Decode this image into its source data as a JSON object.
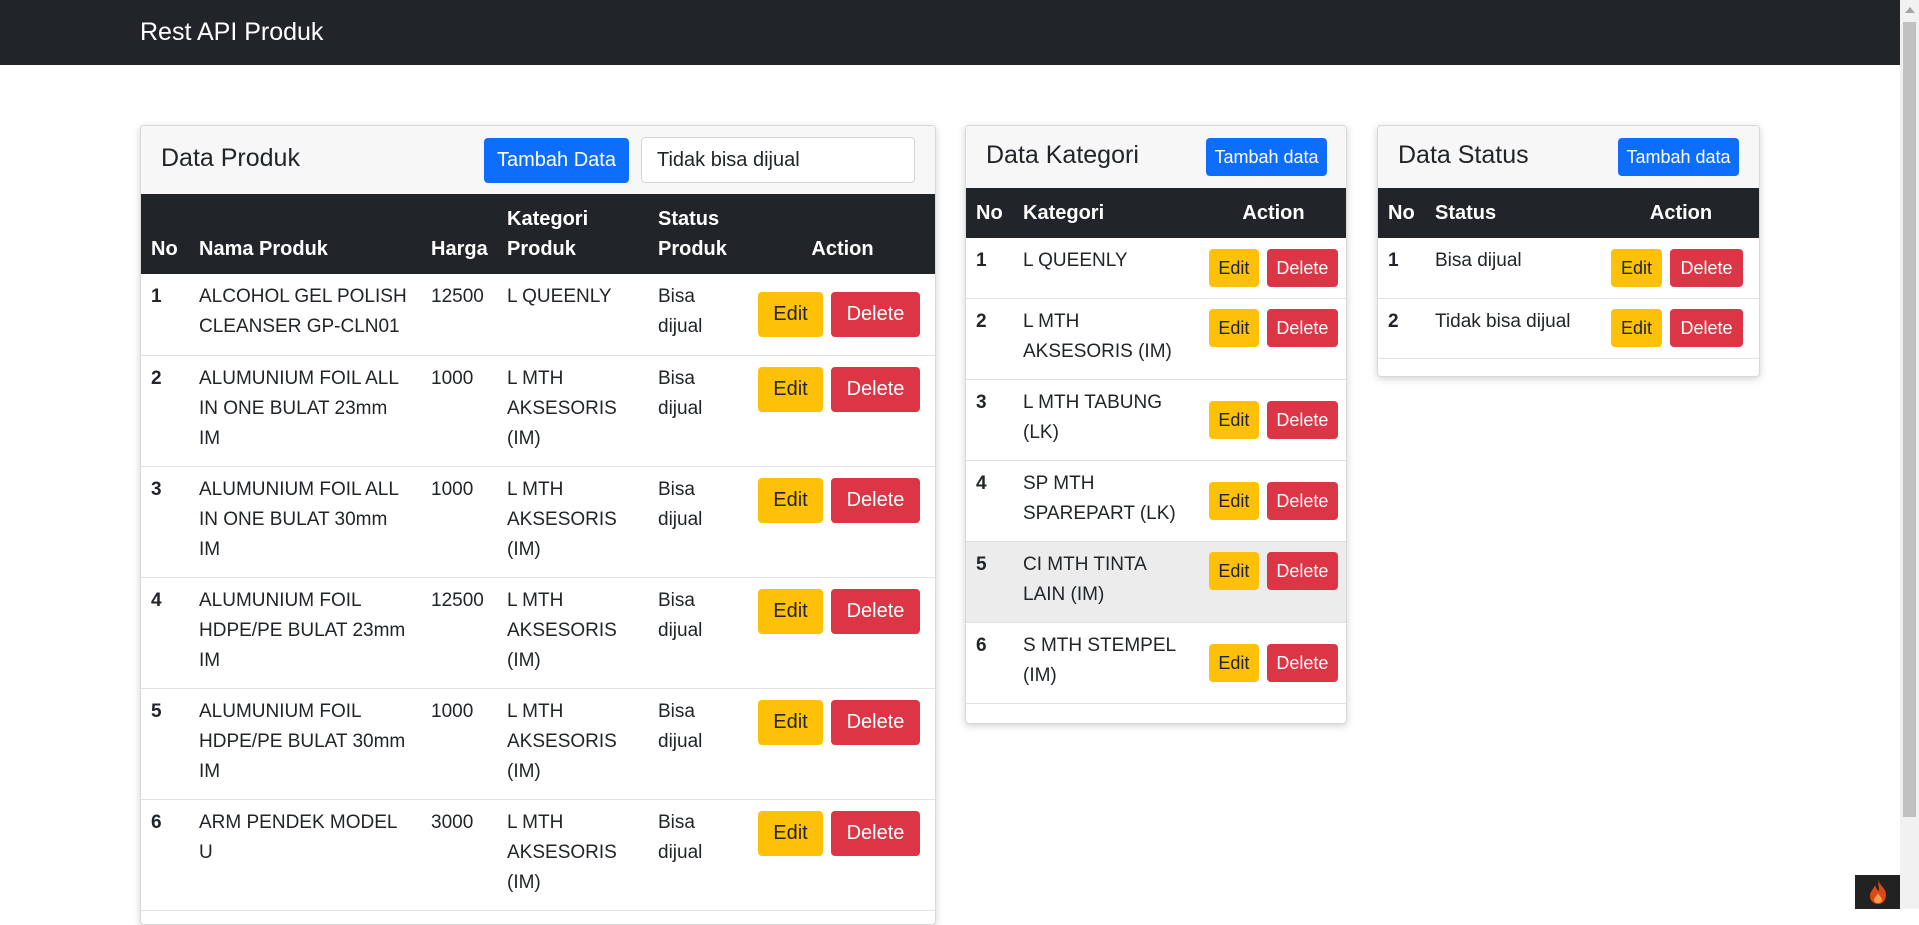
{
  "app": {
    "brand": "Rest API Produk"
  },
  "produk": {
    "title": "Data Produk",
    "add_label": "Tambah Data",
    "search_value": "Tidak bisa dijual",
    "columns": [
      "No",
      "Nama Produk",
      "Harga",
      "Kategori Produk",
      "Status Produk",
      "Action"
    ],
    "rows": [
      {
        "no": "1",
        "nama": "ALCOHOL GEL POLISH CLEANSER GP-CLN01",
        "harga": "12500",
        "kategori": "L QUEENLY",
        "status": "Bisa dijual"
      },
      {
        "no": "2",
        "nama": "ALUMUNIUM FOIL ALL IN ONE BULAT 23mm IM",
        "harga": "1000",
        "kategori": "L MTH AKSESORIS (IM)",
        "status": "Bisa dijual"
      },
      {
        "no": "3",
        "nama": "ALUMUNIUM FOIL ALL IN ONE BULAT 30mm IM",
        "harga": "1000",
        "kategori": "L MTH AKSESORIS (IM)",
        "status": "Bisa dijual"
      },
      {
        "no": "4",
        "nama": "ALUMUNIUM FOIL HDPE/PE BULAT 23mm IM",
        "harga": "12500",
        "kategori": "L MTH AKSESORIS (IM)",
        "status": "Bisa dijual"
      },
      {
        "no": "5",
        "nama": "ALUMUNIUM FOIL HDPE/PE BULAT 30mm IM",
        "harga": "1000",
        "kategori": "L MTH AKSESORIS (IM)",
        "status": "Bisa dijual"
      },
      {
        "no": "6",
        "nama": "ARM PENDEK MODEL U",
        "harga": "3000",
        "kategori": "L MTH AKSESORIS (IM)",
        "status": "Bisa dijual"
      }
    ]
  },
  "kategori": {
    "title": "Data Kategori",
    "add_label": "Tambah data",
    "columns": [
      "No",
      "Kategori",
      "Action"
    ],
    "rows": [
      {
        "no": "1",
        "kategori": "L QUEENLY"
      },
      {
        "no": "2",
        "kategori": "L MTH AKSESORIS (IM)"
      },
      {
        "no": "3",
        "kategori": "L MTH TABUNG (LK)"
      },
      {
        "no": "4",
        "kategori": "SP MTH SPAREPART (LK)"
      },
      {
        "no": "5",
        "kategori": "CI MTH TINTA LAIN (IM)"
      },
      {
        "no": "6",
        "kategori": "S MTH STEMPEL (IM)"
      }
    ]
  },
  "status": {
    "title": "Data Status",
    "add_label": "Tambah data",
    "columns": [
      "No",
      "Status",
      "Action"
    ],
    "rows": [
      {
        "no": "1",
        "status": "Bisa dijual"
      },
      {
        "no": "2",
        "status": "Tidak bisa dijual"
      }
    ]
  },
  "actions": {
    "edit": "Edit",
    "delete": "Delete"
  },
  "colors": {
    "navbar": "#212529",
    "primary": "#0d6efd",
    "warning": "#ffc107",
    "danger": "#dc3545"
  },
  "icons": {
    "corner_badge": "flame-icon"
  }
}
